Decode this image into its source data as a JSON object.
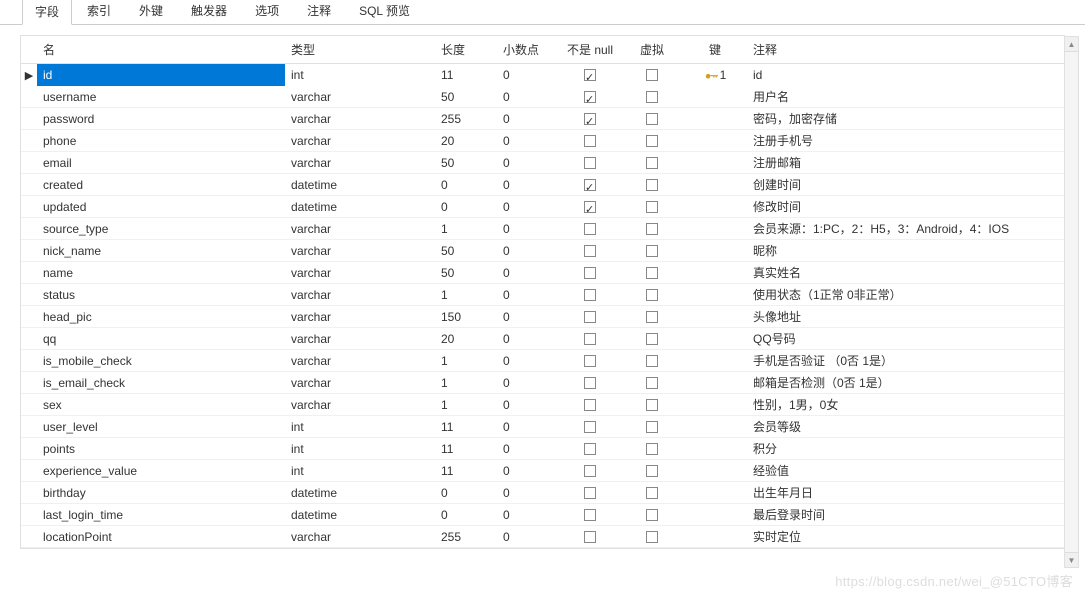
{
  "tabs": {
    "fields": "字段",
    "indexes": "索引",
    "foreign_keys": "外键",
    "triggers": "触发器",
    "options": "选项",
    "comment": "注释",
    "sql_preview": "SQL 预览"
  },
  "headers": {
    "name": "名",
    "type": "类型",
    "length": "长度",
    "decimals": "小数点",
    "not_null": "不是 null",
    "virtual": "虚拟",
    "key": "键",
    "comment": "注释"
  },
  "key_label": "1",
  "rows": [
    {
      "name": "id",
      "type": "int",
      "len": "11",
      "dec": "0",
      "nn": true,
      "virt": false,
      "key": true,
      "comment": "id",
      "selected": true
    },
    {
      "name": "username",
      "type": "varchar",
      "len": "50",
      "dec": "0",
      "nn": true,
      "virt": false,
      "key": false,
      "comment": "用户名"
    },
    {
      "name": "password",
      "type": "varchar",
      "len": "255",
      "dec": "0",
      "nn": true,
      "virt": false,
      "key": false,
      "comment": "密码，加密存储"
    },
    {
      "name": "phone",
      "type": "varchar",
      "len": "20",
      "dec": "0",
      "nn": false,
      "virt": false,
      "key": false,
      "comment": "注册手机号"
    },
    {
      "name": "email",
      "type": "varchar",
      "len": "50",
      "dec": "0",
      "nn": false,
      "virt": false,
      "key": false,
      "comment": "注册邮箱"
    },
    {
      "name": "created",
      "type": "datetime",
      "len": "0",
      "dec": "0",
      "nn": true,
      "virt": false,
      "key": false,
      "comment": "创建时间"
    },
    {
      "name": "updated",
      "type": "datetime",
      "len": "0",
      "dec": "0",
      "nn": true,
      "virt": false,
      "key": false,
      "comment": "修改时间"
    },
    {
      "name": "source_type",
      "type": "varchar",
      "len": "1",
      "dec": "0",
      "nn": false,
      "virt": false,
      "key": false,
      "comment": "会员来源：1:PC，2：H5，3：Android，4：IOS"
    },
    {
      "name": "nick_name",
      "type": "varchar",
      "len": "50",
      "dec": "0",
      "nn": false,
      "virt": false,
      "key": false,
      "comment": "昵称"
    },
    {
      "name": "name",
      "type": "varchar",
      "len": "50",
      "dec": "0",
      "nn": false,
      "virt": false,
      "key": false,
      "comment": "真实姓名"
    },
    {
      "name": "status",
      "type": "varchar",
      "len": "1",
      "dec": "0",
      "nn": false,
      "virt": false,
      "key": false,
      "comment": "使用状态（1正常 0非正常）"
    },
    {
      "name": "head_pic",
      "type": "varchar",
      "len": "150",
      "dec": "0",
      "nn": false,
      "virt": false,
      "key": false,
      "comment": "头像地址"
    },
    {
      "name": "qq",
      "type": "varchar",
      "len": "20",
      "dec": "0",
      "nn": false,
      "virt": false,
      "key": false,
      "comment": "QQ号码"
    },
    {
      "name": "is_mobile_check",
      "type": "varchar",
      "len": "1",
      "dec": "0",
      "nn": false,
      "virt": false,
      "key": false,
      "comment": "手机是否验证 （0否  1是）"
    },
    {
      "name": "is_email_check",
      "type": "varchar",
      "len": "1",
      "dec": "0",
      "nn": false,
      "virt": false,
      "key": false,
      "comment": "邮箱是否检测（0否  1是）"
    },
    {
      "name": "sex",
      "type": "varchar",
      "len": "1",
      "dec": "0",
      "nn": false,
      "virt": false,
      "key": false,
      "comment": "性别，1男，0女"
    },
    {
      "name": "user_level",
      "type": "int",
      "len": "11",
      "dec": "0",
      "nn": false,
      "virt": false,
      "key": false,
      "comment": "会员等级"
    },
    {
      "name": "points",
      "type": "int",
      "len": "11",
      "dec": "0",
      "nn": false,
      "virt": false,
      "key": false,
      "comment": "积分"
    },
    {
      "name": "experience_value",
      "type": "int",
      "len": "11",
      "dec": "0",
      "nn": false,
      "virt": false,
      "key": false,
      "comment": "经验值"
    },
    {
      "name": "birthday",
      "type": "datetime",
      "len": "0",
      "dec": "0",
      "nn": false,
      "virt": false,
      "key": false,
      "comment": "出生年月日"
    },
    {
      "name": "last_login_time",
      "type": "datetime",
      "len": "0",
      "dec": "0",
      "nn": false,
      "virt": false,
      "key": false,
      "comment": "最后登录时间"
    },
    {
      "name": "locationPoint",
      "type": "varchar",
      "len": "255",
      "dec": "0",
      "nn": false,
      "virt": false,
      "key": false,
      "comment": "实时定位"
    }
  ],
  "watermark": "https://blog.csdn.net/wei_@51CTO博客"
}
